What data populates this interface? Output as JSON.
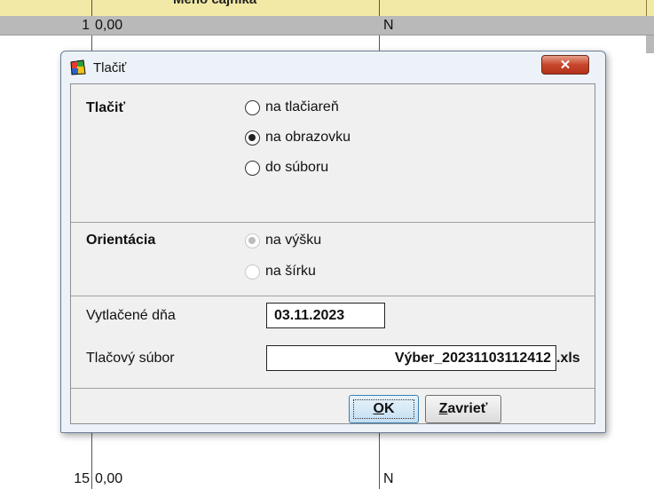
{
  "background": {
    "header_label": "Meno čajníka",
    "rows": [
      {
        "num": "1",
        "value": "0,00",
        "flag": "N",
        "selected": true
      },
      {
        "num": "15",
        "value": "0,00",
        "flag": "N",
        "selected": false
      }
    ]
  },
  "dialog": {
    "title": "Tlačiť",
    "close_label": "✕",
    "print_group": {
      "label": "Tlačiť",
      "options": [
        {
          "label": "na tlačiareň",
          "checked": false
        },
        {
          "label": "na obrazovku",
          "checked": true
        },
        {
          "label": "do súboru",
          "checked": false
        }
      ]
    },
    "orientation_group": {
      "label": "Orientácia",
      "options": [
        {
          "label": "na výšku",
          "checked": true
        },
        {
          "label": "na šírku",
          "checked": false
        }
      ]
    },
    "printed_date": {
      "label": "Vytlačené dňa",
      "value": "03.11.2023"
    },
    "print_file": {
      "label": "Tlačový súbor",
      "value": "Výber_20231103112412",
      "extension": ".xls"
    },
    "buttons": {
      "ok_mnemonic": "O",
      "ok_rest": "K",
      "close_mnemonic": "Z",
      "close_rest": "avrieť"
    }
  },
  "colors": {
    "header": "#f3e9a6",
    "close_button": "#c7462b",
    "dialog_frame": "#ecf2f8"
  }
}
